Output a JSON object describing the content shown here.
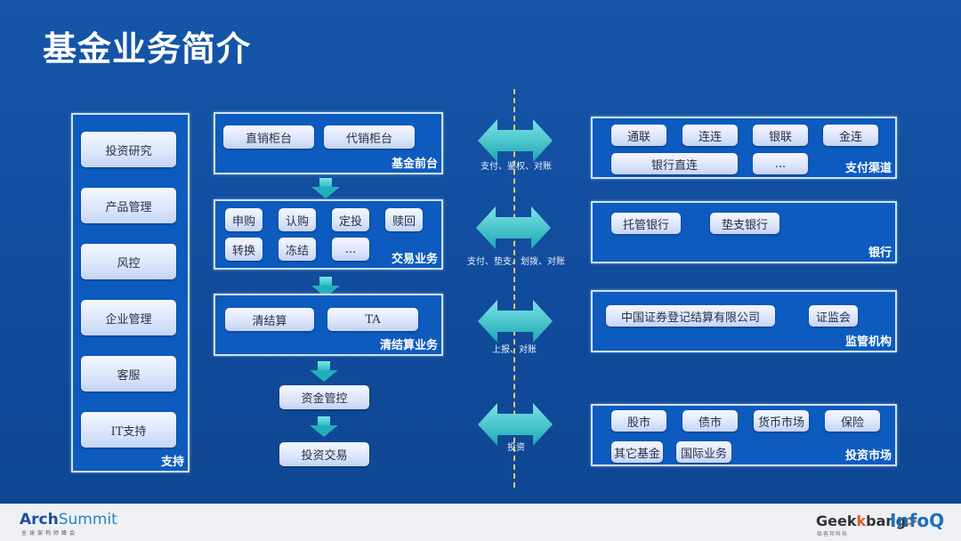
{
  "title": "基金业务简介",
  "support": {
    "label": "支持",
    "items": [
      "投资研究",
      "产品管理",
      "风控",
      "企业管理",
      "客服",
      "IT支持"
    ]
  },
  "front": {
    "label": "基金前台",
    "items": [
      "直销柜台",
      "代销柜台"
    ]
  },
  "trading": {
    "label": "交易业务",
    "items": [
      "申购",
      "认购",
      "定投",
      "赎回",
      "转换",
      "冻结",
      "..."
    ]
  },
  "clearing": {
    "label": "清结算业务",
    "items": [
      "清结算",
      "TA"
    ]
  },
  "flow": {
    "fund_control": "资金管控",
    "investment_trading": "投资交易"
  },
  "connections": [
    {
      "label": "支付、鉴权、对账"
    },
    {
      "label": "支付、垫支、划拨、对账"
    },
    {
      "label": "上报、对账"
    },
    {
      "label": "投资"
    }
  ],
  "payment_channels": {
    "label": "支付渠道",
    "items": [
      "通联",
      "连连",
      "银联",
      "金连",
      "银行直连",
      "..."
    ]
  },
  "banks": {
    "label": "银行",
    "items": [
      "托管银行",
      "垫支银行"
    ]
  },
  "regulators": {
    "label": "监管机构",
    "items": [
      "中国证券登记结算有限公司",
      "证监会"
    ]
  },
  "investment_market": {
    "label": "投资市场",
    "items": [
      "股市",
      "债市",
      "货币市场",
      "保险",
      "其它基金",
      "国际业务"
    ]
  },
  "footer": {
    "left_logo": {
      "part1": "Arch",
      "part2": "Summit",
      "sub": "全球架构师峰会"
    },
    "right_logo1": {
      "part1": "Geek",
      "part2": "bang",
      "mark": ">.",
      "sub": "极客邦科技"
    },
    "right_logo2": "InfoQ"
  },
  "colors": {
    "background": "#1250a0",
    "panel": "#0d5bbf",
    "panel_border": "#cfe2ff",
    "arrow": "#22b0b8",
    "divider": "#e8c66a"
  }
}
